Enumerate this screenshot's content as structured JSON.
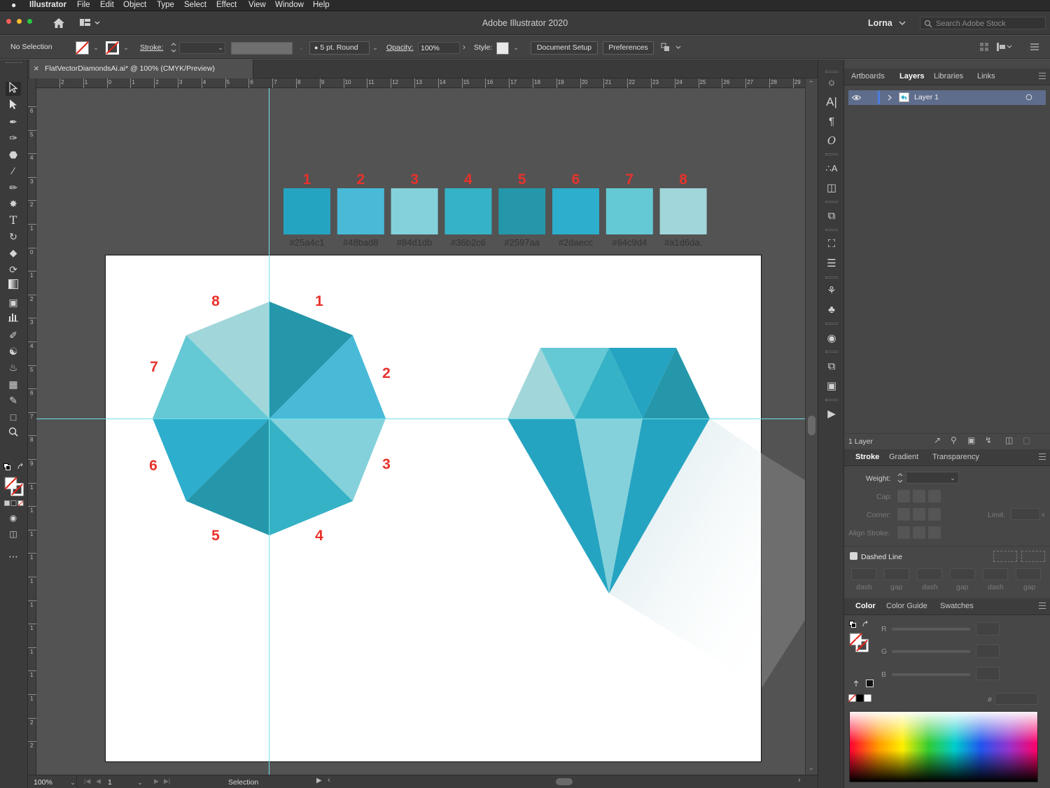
{
  "menubar": {
    "app_name": "Illustrator",
    "items": [
      "File",
      "Edit",
      "Object",
      "Type",
      "Select",
      "Effect",
      "View",
      "Window",
      "Help"
    ]
  },
  "titlebar": {
    "title": "Adobe Illustrator 2020",
    "user": "Lorna",
    "search_placeholder": "Search Adobe Stock"
  },
  "control_bar": {
    "selection_status": "No Selection",
    "stroke_label": "Stroke:",
    "brush_label": "5 pt. Round",
    "opacity_label": "Opacity:",
    "opacity_value": "100%",
    "style_label": "Style:",
    "document_setup": "Document Setup",
    "preferences": "Preferences"
  },
  "document": {
    "tab_title": "FlatVectorDiamondsAi.ai* @ 100% (CMYK/Preview)"
  },
  "rulers": {
    "horizontal": [
      "2",
      "1",
      "0",
      "1",
      "2",
      "3",
      "4",
      "5",
      "6",
      "7",
      "8",
      "9",
      "10",
      "11",
      "12",
      "13",
      "14",
      "15",
      "16",
      "17",
      "18",
      "19",
      "20",
      "21",
      "22",
      "23",
      "24",
      "25",
      "26",
      "27",
      "28",
      "29"
    ],
    "vertical": [
      "6",
      "5",
      "4",
      "3",
      "2",
      "1",
      "0",
      "1",
      "2",
      "3",
      "4",
      "5",
      "6",
      "7",
      "8",
      "9",
      "1",
      "1",
      "1",
      "1",
      "1",
      "1",
      "1",
      "1",
      "1",
      "1",
      "2",
      "2"
    ]
  },
  "artwork": {
    "swatches": [
      {
        "number": "1",
        "hex": "#25a4c1",
        "color": "#25a4c1"
      },
      {
        "number": "2",
        "hex": "#48bad8",
        "color": "#48bad8"
      },
      {
        "number": "3",
        "hex": "#84d1db",
        "color": "#84d1db"
      },
      {
        "number": "4",
        "hex": "#36b2c6",
        "color": "#36b2c6"
      },
      {
        "number": "5",
        "hex": "#2597aa",
        "color": "#2597aa"
      },
      {
        "number": "6",
        "hex": "#2daecc",
        "color": "#2daecc"
      },
      {
        "number": "7",
        "hex": "#64c9d4",
        "color": "#64c9d4"
      },
      {
        "number": "8",
        "hex": "#a1d6da.",
        "color": "#a1d6da"
      }
    ],
    "octagon_labels": [
      "8",
      "1",
      "7",
      "2",
      "6",
      "3",
      "5",
      "4"
    ],
    "label_color": "#e8322b"
  },
  "statusbar": {
    "zoom": "100%",
    "artboard_number": "1",
    "current_tool": "Selection"
  },
  "layers_panel": {
    "tabs": [
      "Artboards",
      "Layers",
      "Libraries",
      "Links"
    ],
    "active_tab": "Layers",
    "layer_name": "Layer 1",
    "layer_count": "1 Layer"
  },
  "stroke_panel": {
    "tabs": [
      "Stroke",
      "Gradient",
      "Transparency"
    ],
    "weight_label": "Weight:",
    "cap_label": "Cap:",
    "corner_label": "Corner:",
    "limit_label": "Limit:",
    "align_label": "Align Stroke:",
    "dashed_label": "Dashed Line",
    "dash_labels": [
      "dash",
      "gap",
      "dash",
      "gap",
      "dash",
      "gap"
    ]
  },
  "color_panel": {
    "tabs": [
      "Color",
      "Color Guide",
      "Swatches"
    ],
    "channels": [
      "R",
      "G",
      "B"
    ],
    "hex_label": "#"
  },
  "colors": {
    "guide": "#6fe0ea",
    "accent_blue": "#4c7de0",
    "ui_dark": "#3b3b3b"
  }
}
